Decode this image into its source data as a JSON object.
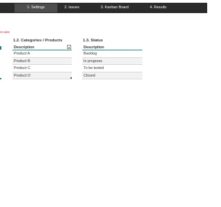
{
  "nav": {
    "tabs": [
      {
        "label": "1. Settings",
        "active": true
      },
      {
        "label": "2. Issues",
        "active": false
      },
      {
        "label": "3. Kanban Board",
        "active": false
      },
      {
        "label": "4. Results",
        "active": false
      }
    ]
  },
  "note_text": "nt tabs",
  "categories": {
    "title": "1.2. Categories / Products",
    "header": "Description",
    "rows": [
      "Product A",
      "Product B",
      "Product C",
      "Product D"
    ]
  },
  "status": {
    "title": "1.3. Status",
    "header": "Description",
    "rows": [
      "Backlog",
      "In progress",
      "To be tested",
      "Closed"
    ]
  },
  "colors": {
    "nav_bg": "#2b2b2b",
    "active_tab_bg": "#4d4d4d",
    "header_underline": "#1f7f7f",
    "note": "#e02020"
  },
  "icons": {
    "filter_dropdown": "chevron-down-icon"
  }
}
